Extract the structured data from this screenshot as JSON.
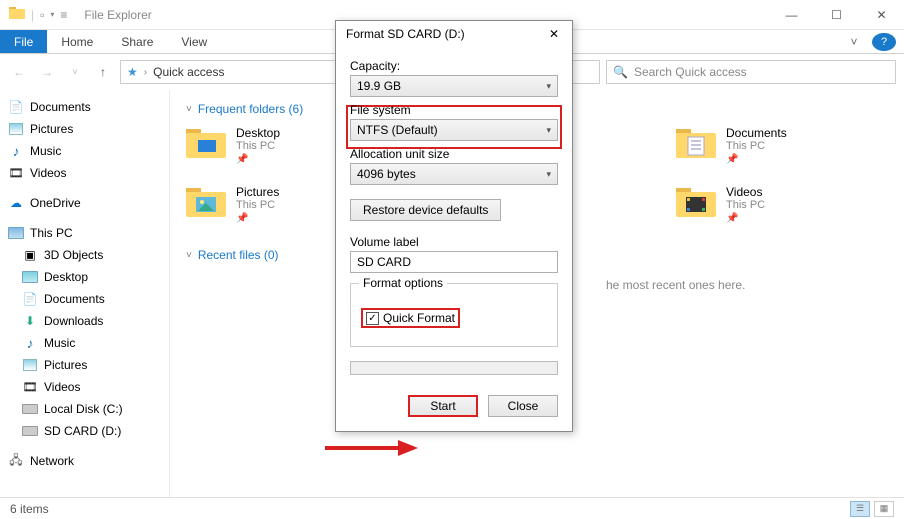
{
  "title": "File Explorer",
  "ribbon": {
    "file": "File",
    "home": "Home",
    "share": "Share",
    "view": "View"
  },
  "breadcrumb": "Quick access",
  "search_placeholder": "Search Quick access",
  "sections": {
    "frequent_label": "Frequent folders (6)",
    "recent_label": "Recent files (0)",
    "recent_hint": "he most recent ones here."
  },
  "folders": {
    "desktop": {
      "name": "Desktop",
      "sub": "This PC"
    },
    "pictures": {
      "name": "Pictures",
      "sub": "This PC"
    },
    "documents": {
      "name": "Documents",
      "sub": "This PC"
    },
    "videos": {
      "name": "Videos",
      "sub": "This PC"
    }
  },
  "sidebar": {
    "documents": "Documents",
    "pictures": "Pictures",
    "music": "Music",
    "videos": "Videos",
    "onedrive": "OneDrive",
    "thispc": "This PC",
    "objects3d": "3D Objects",
    "desktop": "Desktop",
    "documents2": "Documents",
    "downloads": "Downloads",
    "music2": "Music",
    "pictures2": "Pictures",
    "videos2": "Videos",
    "localdisk": "Local Disk (C:)",
    "sdcard": "SD CARD (D:)",
    "network": "Network"
  },
  "statusbar": {
    "items": "6 items"
  },
  "dialog": {
    "title": "Format SD CARD (D:)",
    "capacity_label": "Capacity:",
    "capacity_value": "19.9 GB",
    "fs_label": "File system",
    "fs_value": "NTFS (Default)",
    "alloc_label": "Allocation unit size",
    "alloc_value": "4096 bytes",
    "restore": "Restore device defaults",
    "volume_label_label": "Volume label",
    "volume_label_value": "SD CARD",
    "format_options": "Format options",
    "quick_format": "Quick Format",
    "start": "Start",
    "close": "Close"
  }
}
